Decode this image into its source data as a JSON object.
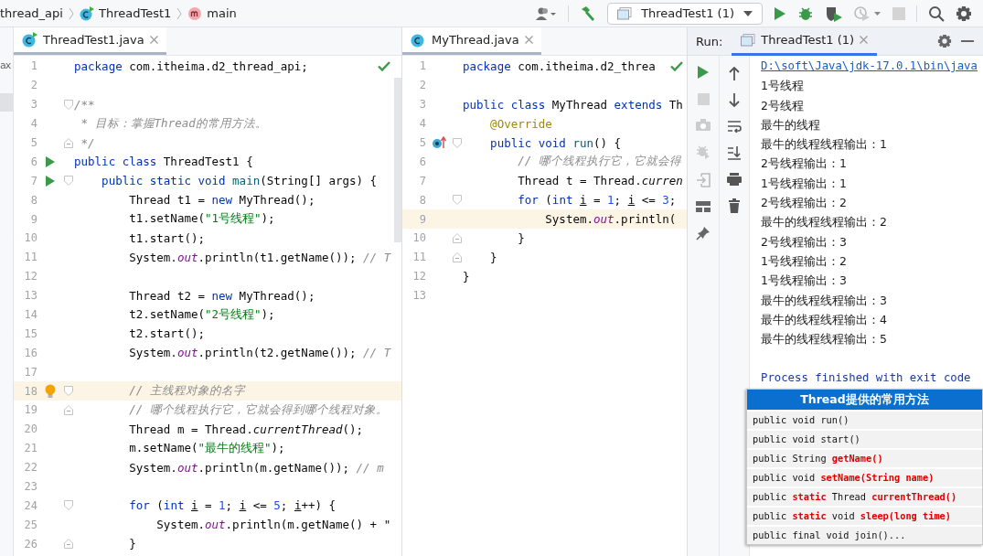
{
  "breadcrumbs": [
    {
      "label": "thread_api",
      "kind": "package"
    },
    {
      "label": "ThreadTest1",
      "kind": "class"
    },
    {
      "label": "main",
      "kind": "method"
    }
  ],
  "toolbar": {
    "run_config": "ThreadTest1 (1)"
  },
  "project_panel": {
    "label": "ax"
  },
  "editors": [
    {
      "tab": {
        "label": "ThreadTest1.java",
        "selected": true,
        "kind": "runnable"
      },
      "lines": [
        {
          "n": "1",
          "current": false,
          "tokens": [
            {
              "t": "package",
              "kind": "kw"
            },
            {
              "t": " com.itheima.d2_thread_api;",
              "kind": "plain"
            }
          ]
        },
        {
          "n": "2",
          "current": false
        },
        {
          "n": "3",
          "current": false,
          "fold": {
            "kind": "start"
          },
          "tokens": [
            {
              "t": "/**",
              "kind": "cmt"
            }
          ]
        },
        {
          "n": "4",
          "current": false,
          "tokens": [
            {
              "t": " * 目标：掌握Thread的常用方法。",
              "kind": "cmt"
            }
          ]
        },
        {
          "n": "5",
          "current": false,
          "fold": {
            "kind": "end"
          },
          "tokens": [
            {
              "t": " */",
              "kind": "cmt"
            }
          ]
        },
        {
          "n": "6",
          "current": false,
          "gutter": {
            "kind": "run"
          },
          "tokens": [
            {
              "t": "public class",
              "kind": "kw"
            },
            {
              "t": " ThreadTest1 {",
              "kind": "plain"
            }
          ]
        },
        {
          "n": "7",
          "current": false,
          "gutter": {
            "kind": "run"
          },
          "fold": {
            "kind": "start"
          },
          "tokens": [
            {
              "t": "    public static void ",
              "kind": "kw"
            },
            {
              "t": "main",
              "kind": "decl"
            },
            {
              "t": "(String[] args) {",
              "kind": "plain"
            }
          ]
        },
        {
          "n": "8",
          "current": false,
          "tokens": [
            {
              "t": "        Thread t1 = ",
              "kind": "plain"
            },
            {
              "t": "new",
              "kind": "kw"
            },
            {
              "t": " MyThread();",
              "kind": "plain"
            }
          ]
        },
        {
          "n": "9",
          "current": false,
          "tokens": [
            {
              "t": "        t1.setName(",
              "kind": "plain"
            },
            {
              "t": "\"1号线程\"",
              "kind": "str"
            },
            {
              "t": ");",
              "kind": "plain"
            }
          ]
        },
        {
          "n": "10",
          "current": false,
          "tokens": [
            {
              "t": "        t1.start();",
              "kind": "plain"
            }
          ]
        },
        {
          "n": "11",
          "current": false,
          "tokens": [
            {
              "t": "        System.",
              "kind": "plain"
            },
            {
              "t": "out",
              "kind": "fld"
            },
            {
              "t": ".println(t1.getName()); ",
              "kind": "plain"
            },
            {
              "t": "// T",
              "kind": "cmt"
            }
          ]
        },
        {
          "n": "12",
          "current": false
        },
        {
          "n": "13",
          "current": false,
          "tokens": [
            {
              "t": "        Thread t2 = ",
              "kind": "plain"
            },
            {
              "t": "new",
              "kind": "kw"
            },
            {
              "t": " MyThread();",
              "kind": "plain"
            }
          ]
        },
        {
          "n": "14",
          "current": false,
          "tokens": [
            {
              "t": "        t2.setName(",
              "kind": "plain"
            },
            {
              "t": "\"2号线程\"",
              "kind": "str"
            },
            {
              "t": ");",
              "kind": "plain"
            }
          ]
        },
        {
          "n": "15",
          "current": false,
          "tokens": [
            {
              "t": "        t2.start();",
              "kind": "plain"
            }
          ]
        },
        {
          "n": "16",
          "current": false,
          "tokens": [
            {
              "t": "        System.",
              "kind": "plain"
            },
            {
              "t": "out",
              "kind": "fld"
            },
            {
              "t": ".println(t2.getName()); ",
              "kind": "plain"
            },
            {
              "t": "// T",
              "kind": "cmt"
            }
          ]
        },
        {
          "n": "17",
          "current": false
        },
        {
          "n": "18",
          "current": true,
          "gutter": {
            "kind": "bulb"
          },
          "fold": {
            "kind": "start"
          },
          "tokens": [
            {
              "t": "        // 主线程对象的名字",
              "kind": "cmt"
            }
          ]
        },
        {
          "n": "19",
          "current": false,
          "fold": {
            "kind": "end"
          },
          "tokens": [
            {
              "t": "        // 哪个线程执行它，它就会得到哪个线程对象。",
              "kind": "cmt"
            }
          ]
        },
        {
          "n": "20",
          "current": false,
          "tokens": [
            {
              "t": "        Thread m = Thread.",
              "kind": "plain"
            },
            {
              "t": "currentThread",
              "kind": "itl"
            },
            {
              "t": "();",
              "kind": "plain"
            }
          ]
        },
        {
          "n": "21",
          "current": false,
          "tokens": [
            {
              "t": "        m.setName(",
              "kind": "plain"
            },
            {
              "t": "\"最牛的线程\"",
              "kind": "str"
            },
            {
              "t": ");",
              "kind": "plain"
            }
          ]
        },
        {
          "n": "22",
          "current": false,
          "tokens": [
            {
              "t": "        System.",
              "kind": "plain"
            },
            {
              "t": "out",
              "kind": "fld"
            },
            {
              "t": ".println(m.getName()); ",
              "kind": "plain"
            },
            {
              "t": "// m",
              "kind": "cmt"
            }
          ]
        },
        {
          "n": "23",
          "current": false
        },
        {
          "n": "24",
          "current": false,
          "fold": {
            "kind": "start"
          },
          "tokens": [
            {
              "t": "        for",
              "kind": "kw"
            },
            {
              "t": " (",
              "kind": "plain"
            },
            {
              "t": "int ",
              "kind": "kw"
            },
            {
              "t": "i",
              "kind": "var"
            },
            {
              "t": " = ",
              "kind": "plain"
            },
            {
              "t": "1",
              "kind": "num"
            },
            {
              "t": "; ",
              "kind": "plain"
            },
            {
              "t": "i",
              "kind": "var"
            },
            {
              "t": " <= ",
              "kind": "plain"
            },
            {
              "t": "5",
              "kind": "num"
            },
            {
              "t": "; ",
              "kind": "plain"
            },
            {
              "t": "i",
              "kind": "var"
            },
            {
              "t": "++) {",
              "kind": "plain"
            }
          ]
        },
        {
          "n": "25",
          "current": false,
          "tokens": [
            {
              "t": "            System.",
              "kind": "plain"
            },
            {
              "t": "out",
              "kind": "fld"
            },
            {
              "t": ".println(m.getName() + \"",
              "kind": "plain"
            }
          ]
        },
        {
          "n": "26",
          "current": false,
          "fold": {
            "kind": "end"
          },
          "tokens": [
            {
              "t": "        }",
              "kind": "plain"
            }
          ]
        }
      ]
    },
    {
      "tab": {
        "label": "MyThread.java",
        "selected": true,
        "kind": "class"
      },
      "lines": [
        {
          "n": "1",
          "current": false,
          "tokens": [
            {
              "t": "package",
              "kind": "kw"
            },
            {
              "t": " com.itheima.d2_threa",
              "kind": "plain"
            }
          ]
        },
        {
          "n": "2",
          "current": false
        },
        {
          "n": "3",
          "current": false,
          "tokens": [
            {
              "t": "public class",
              "kind": "kw"
            },
            {
              "t": " MyThread ",
              "kind": "plain"
            },
            {
              "t": "extends",
              "kind": "kw"
            },
            {
              "t": " Th",
              "kind": "plain"
            }
          ]
        },
        {
          "n": "4",
          "current": false,
          "tokens": [
            {
              "t": "    @Override",
              "kind": "ann"
            }
          ]
        },
        {
          "n": "5",
          "current": false,
          "gutter": {
            "kind": "override"
          },
          "fold": {
            "kind": "start"
          },
          "tokens": [
            {
              "t": "    public void ",
              "kind": "kw"
            },
            {
              "t": "run",
              "kind": "decl"
            },
            {
              "t": "() {",
              "kind": "plain"
            }
          ]
        },
        {
          "n": "6",
          "current": false,
          "tokens": [
            {
              "t": "        // 哪个线程执行它，它就会得",
              "kind": "cmt"
            }
          ]
        },
        {
          "n": "7",
          "current": false,
          "tokens": [
            {
              "t": "        Thread t = Thread.",
              "kind": "plain"
            },
            {
              "t": "curren",
              "kind": "itl"
            }
          ]
        },
        {
          "n": "8",
          "current": false,
          "fold": {
            "kind": "start"
          },
          "tokens": [
            {
              "t": "        for",
              "kind": "kw"
            },
            {
              "t": " (",
              "kind": "plain"
            },
            {
              "t": "int ",
              "kind": "kw"
            },
            {
              "t": "i",
              "kind": "var"
            },
            {
              "t": " = ",
              "kind": "plain"
            },
            {
              "t": "1",
              "kind": "num"
            },
            {
              "t": "; ",
              "kind": "plain"
            },
            {
              "t": "i",
              "kind": "var"
            },
            {
              "t": " <= ",
              "kind": "plain"
            },
            {
              "t": "3",
              "kind": "num"
            },
            {
              "t": ";",
              "kind": "plain"
            }
          ]
        },
        {
          "n": "9",
          "current": true,
          "tokens": [
            {
              "t": "            System.",
              "kind": "plain"
            },
            {
              "t": "out",
              "kind": "fld"
            },
            {
              "t": ".println(",
              "kind": "plain"
            }
          ]
        },
        {
          "n": "10",
          "current": false,
          "fold": {
            "kind": "end"
          },
          "tokens": [
            {
              "t": "        }",
              "kind": "plain"
            }
          ]
        },
        {
          "n": "11",
          "current": false,
          "fold": {
            "kind": "end"
          },
          "tokens": [
            {
              "t": "    }",
              "kind": "plain"
            }
          ]
        },
        {
          "n": "12",
          "current": false,
          "tokens": [
            {
              "t": "}",
              "kind": "plain"
            }
          ]
        },
        {
          "n": "13",
          "current": false
        }
      ]
    }
  ],
  "run_panel": {
    "label": "Run:",
    "tab": {
      "label": "ThreadTest1 (1)",
      "selected": true
    },
    "console": [
      {
        "kind": "link",
        "text": "D:\\soft\\Java\\jdk-17.0.1\\bin\\java"
      },
      {
        "kind": "out",
        "text": "1号线程"
      },
      {
        "kind": "out",
        "text": "2号线程"
      },
      {
        "kind": "out",
        "text": "最牛的线程"
      },
      {
        "kind": "out",
        "text": "最牛的线程线程输出：1"
      },
      {
        "kind": "out",
        "text": "2号线程输出：1"
      },
      {
        "kind": "out",
        "text": "1号线程输出：1"
      },
      {
        "kind": "out",
        "text": "2号线程输出：2"
      },
      {
        "kind": "out",
        "text": "最牛的线程线程输出：2"
      },
      {
        "kind": "out",
        "text": "2号线程输出：3"
      },
      {
        "kind": "out",
        "text": "1号线程输出：2"
      },
      {
        "kind": "out",
        "text": "1号线程输出：3"
      },
      {
        "kind": "out",
        "text": "最牛的线程线程输出：3"
      },
      {
        "kind": "out",
        "text": "最牛的线程线程输出：4"
      },
      {
        "kind": "out",
        "text": "最牛的线程线程输出：5"
      },
      {
        "kind": "blank"
      },
      {
        "kind": "exit",
        "text": "Process finished with exit code"
      }
    ]
  },
  "overlay": {
    "title": "Thread提供的常用方法",
    "rows": [
      "public void run()",
      "public void start()",
      "public String **getName()**",
      "public void **setName(String name)**",
      "public **static** Thread **currentThread()**",
      "public **static** void **sleep(long time)**",
      "public final void join()..."
    ]
  }
}
